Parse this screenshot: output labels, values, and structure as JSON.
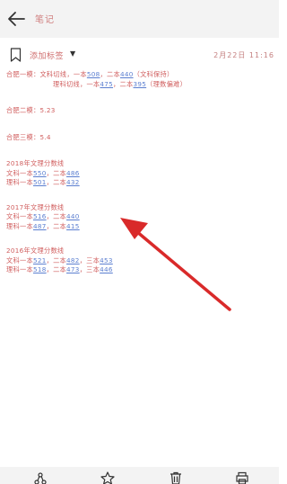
{
  "header": {
    "title": "笔记"
  },
  "tagbar": {
    "tag_label": "添加标签",
    "caret": "▼",
    "datetime": "2月22日 11:16"
  },
  "note": {
    "l1": {
      "a": "合肥一模：文科切线，一本",
      "v1": "508",
      "b": "，二本",
      "v2": "440",
      "c": "（文科保持）"
    },
    "l2": {
      "a": "理科切线，一本",
      "v1": "475",
      "b": "，二本",
      "v2": "395",
      "c": "（理数偏难）"
    },
    "l3": "合肥二模：5.23",
    "l4": "合肥三模：5.4",
    "l5": "2018年文理分数线",
    "l6": {
      "a": "文科一本",
      "v1": "550",
      "b": "，二本",
      "v2": "486"
    },
    "l7": {
      "a": "理科一本",
      "v1": "501",
      "b": "，二本",
      "v2": "432"
    },
    "l8": "2017年文理分数线",
    "l9": {
      "a": "文科一本",
      "v1": "516",
      "b": "，二本",
      "v2": "440"
    },
    "l10": {
      "a": "理科一本",
      "v1": "487",
      "b": "，二本",
      "v2": "415"
    },
    "l11": "2016年文理分数线",
    "l12": {
      "a": "文科一本",
      "v1": "521",
      "b": "，二本",
      "v2": "482",
      "c": "，三本",
      "v3": "453"
    },
    "l13": {
      "a": "理科一本",
      "v1": "518",
      "b": "，二本",
      "v2": "473",
      "c": "，三本",
      "v3": "446"
    }
  }
}
